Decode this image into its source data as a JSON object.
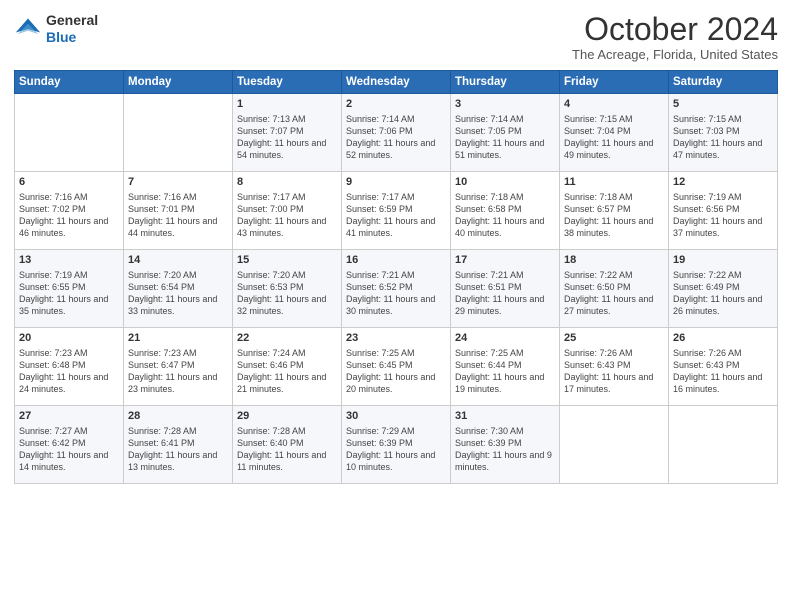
{
  "logo": {
    "general": "General",
    "blue": "Blue"
  },
  "header": {
    "month": "October 2024",
    "location": "The Acreage, Florida, United States"
  },
  "days_of_week": [
    "Sunday",
    "Monday",
    "Tuesday",
    "Wednesday",
    "Thursday",
    "Friday",
    "Saturday"
  ],
  "weeks": [
    [
      {
        "day": "",
        "info": ""
      },
      {
        "day": "",
        "info": ""
      },
      {
        "day": "1",
        "info": "Sunrise: 7:13 AM\nSunset: 7:07 PM\nDaylight: 11 hours and 54 minutes."
      },
      {
        "day": "2",
        "info": "Sunrise: 7:14 AM\nSunset: 7:06 PM\nDaylight: 11 hours and 52 minutes."
      },
      {
        "day": "3",
        "info": "Sunrise: 7:14 AM\nSunset: 7:05 PM\nDaylight: 11 hours and 51 minutes."
      },
      {
        "day": "4",
        "info": "Sunrise: 7:15 AM\nSunset: 7:04 PM\nDaylight: 11 hours and 49 minutes."
      },
      {
        "day": "5",
        "info": "Sunrise: 7:15 AM\nSunset: 7:03 PM\nDaylight: 11 hours and 47 minutes."
      }
    ],
    [
      {
        "day": "6",
        "info": "Sunrise: 7:16 AM\nSunset: 7:02 PM\nDaylight: 11 hours and 46 minutes."
      },
      {
        "day": "7",
        "info": "Sunrise: 7:16 AM\nSunset: 7:01 PM\nDaylight: 11 hours and 44 minutes."
      },
      {
        "day": "8",
        "info": "Sunrise: 7:17 AM\nSunset: 7:00 PM\nDaylight: 11 hours and 43 minutes."
      },
      {
        "day": "9",
        "info": "Sunrise: 7:17 AM\nSunset: 6:59 PM\nDaylight: 11 hours and 41 minutes."
      },
      {
        "day": "10",
        "info": "Sunrise: 7:18 AM\nSunset: 6:58 PM\nDaylight: 11 hours and 40 minutes."
      },
      {
        "day": "11",
        "info": "Sunrise: 7:18 AM\nSunset: 6:57 PM\nDaylight: 11 hours and 38 minutes."
      },
      {
        "day": "12",
        "info": "Sunrise: 7:19 AM\nSunset: 6:56 PM\nDaylight: 11 hours and 37 minutes."
      }
    ],
    [
      {
        "day": "13",
        "info": "Sunrise: 7:19 AM\nSunset: 6:55 PM\nDaylight: 11 hours and 35 minutes."
      },
      {
        "day": "14",
        "info": "Sunrise: 7:20 AM\nSunset: 6:54 PM\nDaylight: 11 hours and 33 minutes."
      },
      {
        "day": "15",
        "info": "Sunrise: 7:20 AM\nSunset: 6:53 PM\nDaylight: 11 hours and 32 minutes."
      },
      {
        "day": "16",
        "info": "Sunrise: 7:21 AM\nSunset: 6:52 PM\nDaylight: 11 hours and 30 minutes."
      },
      {
        "day": "17",
        "info": "Sunrise: 7:21 AM\nSunset: 6:51 PM\nDaylight: 11 hours and 29 minutes."
      },
      {
        "day": "18",
        "info": "Sunrise: 7:22 AM\nSunset: 6:50 PM\nDaylight: 11 hours and 27 minutes."
      },
      {
        "day": "19",
        "info": "Sunrise: 7:22 AM\nSunset: 6:49 PM\nDaylight: 11 hours and 26 minutes."
      }
    ],
    [
      {
        "day": "20",
        "info": "Sunrise: 7:23 AM\nSunset: 6:48 PM\nDaylight: 11 hours and 24 minutes."
      },
      {
        "day": "21",
        "info": "Sunrise: 7:23 AM\nSunset: 6:47 PM\nDaylight: 11 hours and 23 minutes."
      },
      {
        "day": "22",
        "info": "Sunrise: 7:24 AM\nSunset: 6:46 PM\nDaylight: 11 hours and 21 minutes."
      },
      {
        "day": "23",
        "info": "Sunrise: 7:25 AM\nSunset: 6:45 PM\nDaylight: 11 hours and 20 minutes."
      },
      {
        "day": "24",
        "info": "Sunrise: 7:25 AM\nSunset: 6:44 PM\nDaylight: 11 hours and 19 minutes."
      },
      {
        "day": "25",
        "info": "Sunrise: 7:26 AM\nSunset: 6:43 PM\nDaylight: 11 hours and 17 minutes."
      },
      {
        "day": "26",
        "info": "Sunrise: 7:26 AM\nSunset: 6:43 PM\nDaylight: 11 hours and 16 minutes."
      }
    ],
    [
      {
        "day": "27",
        "info": "Sunrise: 7:27 AM\nSunset: 6:42 PM\nDaylight: 11 hours and 14 minutes."
      },
      {
        "day": "28",
        "info": "Sunrise: 7:28 AM\nSunset: 6:41 PM\nDaylight: 11 hours and 13 minutes."
      },
      {
        "day": "29",
        "info": "Sunrise: 7:28 AM\nSunset: 6:40 PM\nDaylight: 11 hours and 11 minutes."
      },
      {
        "day": "30",
        "info": "Sunrise: 7:29 AM\nSunset: 6:39 PM\nDaylight: 11 hours and 10 minutes."
      },
      {
        "day": "31",
        "info": "Sunrise: 7:30 AM\nSunset: 6:39 PM\nDaylight: 11 hours and 9 minutes."
      },
      {
        "day": "",
        "info": ""
      },
      {
        "day": "",
        "info": ""
      }
    ]
  ]
}
